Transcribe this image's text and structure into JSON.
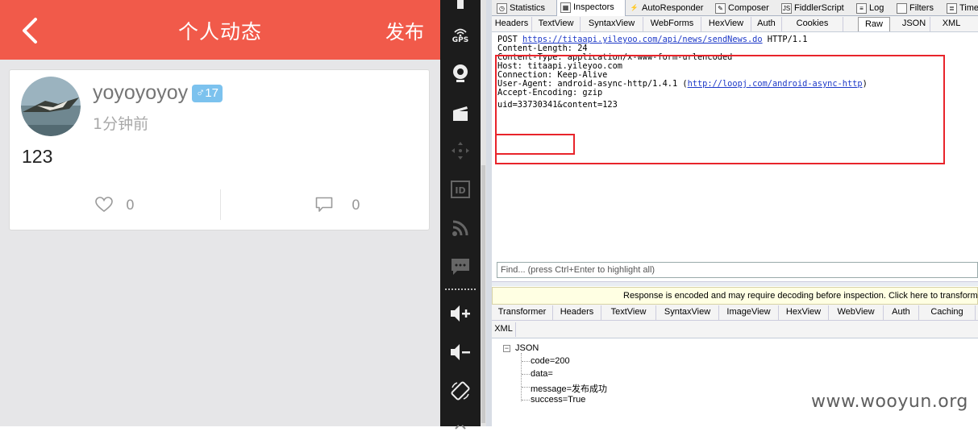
{
  "app": {
    "title": "个人动态",
    "publish_label": "发布",
    "post": {
      "username": "yoyoyoyoy",
      "gender_symbol": "♂",
      "age": "17",
      "time": "1分钟前",
      "content": "123",
      "like_count": "0",
      "comment_count": "0"
    }
  },
  "emulator": {
    "gps_label": "GPS"
  },
  "fiddler": {
    "main_tabs": [
      "Statistics",
      "Inspectors",
      "AutoResponder",
      "Composer",
      "FiddlerScript",
      "Log",
      "Filters",
      "Time"
    ],
    "request_tabs": [
      "Headers",
      "TextView",
      "SyntaxView",
      "WebForms",
      "HexView",
      "Auth",
      "Cookies",
      "Raw",
      "JSON",
      "XML"
    ],
    "active_request_tab": "Raw",
    "raw": {
      "method": "POST",
      "url": "https://titaapi.yileyoo.com/api/news/sendNews.do",
      "protocol": "HTTP/1.1",
      "content_length": "Content-Length: 24",
      "content_type": "Content-Type: application/x-www-form-urlencoded",
      "host": "Host: titaapi.yileyoo.com",
      "connection": "Connection: Keep-Alive",
      "user_agent_prefix": "User-Agent: android-async-http/1.4.1 (",
      "user_agent_link": "http://loopj.com/android-async-http",
      "user_agent_suffix": ")",
      "accept_encoding": "Accept-Encoding: gzip",
      "body_uid": "uid=33730341",
      "body_rest": "&content=123"
    },
    "find_placeholder": "Find... (press Ctrl+Enter to highlight all)",
    "response_notice": "Response is encoded and may require decoding before inspection. Click here to transform.",
    "response_tabs_row1": [
      "Transformer",
      "Headers",
      "TextView",
      "SyntaxView",
      "ImageView",
      "HexView",
      "WebView",
      "Auth",
      "Caching"
    ],
    "response_tabs_row2": [
      "XML"
    ],
    "json_tree": {
      "root": "JSON",
      "items": [
        "code=200",
        "data=",
        "message=发布成功",
        "success=True"
      ]
    }
  },
  "watermark": "www.wooyun.org",
  "colors": {
    "app_bar": "#f15a4a",
    "highlight_box": "#e8242b",
    "badge": "#7cc2ee",
    "link": "#1c38c8"
  }
}
